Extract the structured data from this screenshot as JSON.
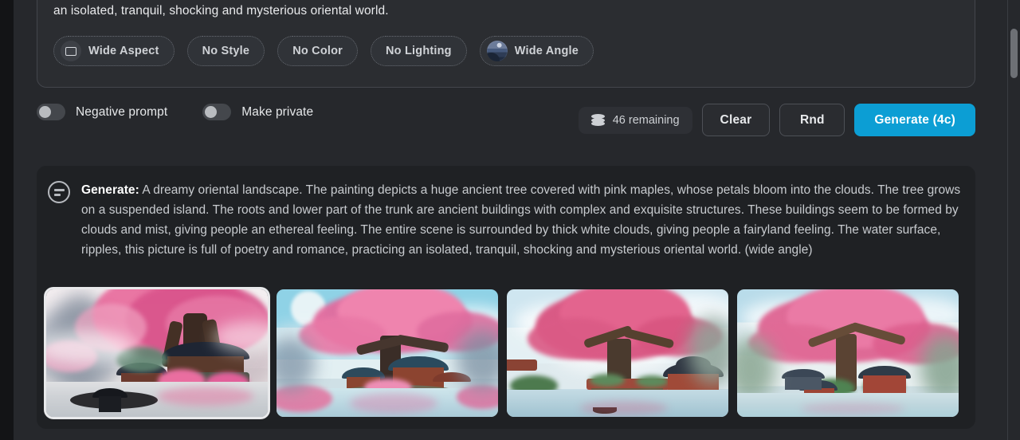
{
  "prompt_panel": {
    "tail_text": "an isolated, tranquil, shocking and mysterious oriental world.",
    "chips": [
      {
        "label": "Wide Aspect",
        "icon": "aspect-frame-icon",
        "has_thumb": false,
        "active": true
      },
      {
        "label": "No Style",
        "icon": null,
        "has_thumb": false,
        "active": false
      },
      {
        "label": "No Color",
        "icon": null,
        "has_thumb": false,
        "active": false
      },
      {
        "label": "No Lighting",
        "icon": null,
        "has_thumb": false,
        "active": false
      },
      {
        "label": "Wide Angle",
        "icon": "wide-angle-thumb-icon",
        "has_thumb": true,
        "active": true
      }
    ]
  },
  "controls": {
    "toggles": [
      {
        "label": "Negative prompt",
        "on": false
      },
      {
        "label": "Make private",
        "on": false
      }
    ],
    "credits": {
      "icon": "coins-stack-icon",
      "text": "46 remaining"
    },
    "buttons": {
      "clear": "Clear",
      "rnd": "Rnd",
      "generate": "Generate (4c)"
    }
  },
  "result": {
    "avatar_icon": "bot-message-icon",
    "label": "Generate:",
    "text": " A dreamy oriental landscape. The painting depicts a huge ancient tree covered with pink maples, whose petals bloom into the clouds. The tree grows on a suspended island. The roots and lower part of the trunk are ancient buildings with complex and exquisite structures. These buildings seem to be formed by clouds and mist, giving people an ethereal feeling. The entire scene is surrounded by thick white clouds, giving people a fairyland feeling. The water surface, ripples, this picture is full of poetry and romance, practicing an isolated, tranquil, shocking and mysterious oriental world. (wide angle)",
    "thumbnails": [
      {
        "alt": "Pink maple tree over misty island with pagodas and reflecting lake",
        "selected": true
      },
      {
        "alt": "Cherry blossom tree on island with moon and blue sky",
        "selected": false
      },
      {
        "alt": "Large pink tree on floating island with boat and red pavilion",
        "selected": false
      },
      {
        "alt": "Ancient pink blossom tree above temple on green island",
        "selected": false
      }
    ]
  },
  "colors": {
    "page_bg": "#26282c",
    "panel_bg": "#2b2d31",
    "card_bg": "#1f2124",
    "accent": "#0c9ed4",
    "text_primary": "#e9eaec",
    "text_secondary": "#c8cbcf",
    "chip_border": "#686c73"
  },
  "scrollbar": {
    "present": true
  }
}
